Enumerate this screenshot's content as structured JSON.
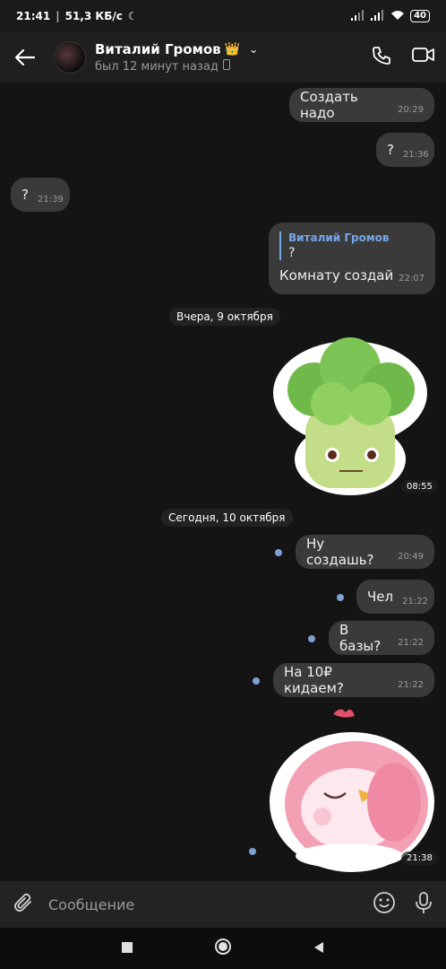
{
  "status": {
    "time": "21:41",
    "speed": "51,3 КБ/с",
    "battery": "40"
  },
  "header": {
    "name": "Виталий Громов",
    "crown_icon": "crown-emoji",
    "last_seen": "был 12 минут назад"
  },
  "messages": [
    {
      "text": "Создать надо",
      "time": "20:29"
    },
    {
      "text": "?",
      "time": "21:36"
    },
    {
      "text": "?",
      "time": "21:39"
    },
    {
      "quote_name": "Виталий Громов",
      "quote_text": "?",
      "text": "Комнату создай",
      "time": "22:07"
    }
  ],
  "dates": {
    "yesterday": "Вчера, 9 октября",
    "today": "Сегодня, 10 октября"
  },
  "sticker1_time": "08:55",
  "messages_today": [
    {
      "text": "Ну создашь?",
      "time": "20:49"
    },
    {
      "text": "Чел",
      "time": "21:22"
    },
    {
      "text": "В базы?",
      "time": "21:22"
    },
    {
      "text": "На 10₽ кидаем?",
      "time": "21:22"
    }
  ],
  "sticker2_time": "21:38",
  "input": {
    "placeholder": "Сообщение"
  }
}
